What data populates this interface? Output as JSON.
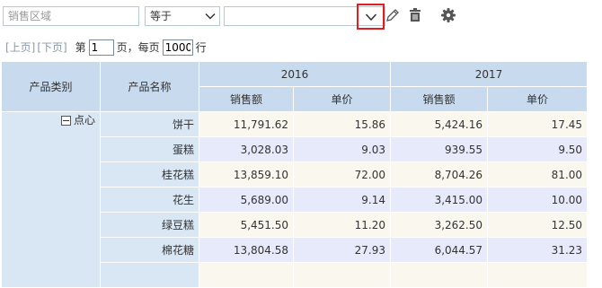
{
  "filter": {
    "field_placeholder": "销售区域",
    "operator": "等于",
    "value": ""
  },
  "pager": {
    "prev": "[上页]",
    "next": "[下页]",
    "page_prefix": "第",
    "page_number": "1",
    "page_suffix": "页，每页",
    "page_size": "1000",
    "rows_suffix": "行"
  },
  "table": {
    "col_category": "产品类别",
    "col_name": "产品名称",
    "years": [
      "2016",
      "2017"
    ],
    "measures": [
      "销售额",
      "单价"
    ],
    "category": "点心",
    "rows": [
      {
        "name": "饼干",
        "v": [
          "11,791.62",
          "15.86",
          "5,424.16",
          "17.45"
        ]
      },
      {
        "name": "蛋糕",
        "v": [
          "3,028.03",
          "9.03",
          "939.55",
          "9.50"
        ]
      },
      {
        "name": "桂花糕",
        "v": [
          "13,859.10",
          "72.00",
          "8,704.26",
          "81.00"
        ]
      },
      {
        "name": "花生",
        "v": [
          "5,689.00",
          "9.14",
          "3,415.00",
          "10.00"
        ]
      },
      {
        "name": "绿豆糕",
        "v": [
          "5,451.50",
          "11.20",
          "3,262.50",
          "12.50"
        ]
      },
      {
        "name": "棉花糖",
        "v": [
          "13,804.58",
          "27.93",
          "6,044.57",
          "31.23"
        ]
      },
      {
        "name": "",
        "v": [
          "",
          "",
          "",
          ""
        ]
      }
    ]
  },
  "icons": {
    "dropdown": "chevron-down-icon",
    "edit": "pencil-icon",
    "delete": "trash-icon",
    "settings": "gear-icon"
  },
  "colors": {
    "header_bg": "#c8daee",
    "dimension_bg": "#d9e6f4",
    "row_odd_bg": "#faf8ee",
    "row_even_bg": "#e6eafa",
    "highlight_border": "#e02020"
  }
}
